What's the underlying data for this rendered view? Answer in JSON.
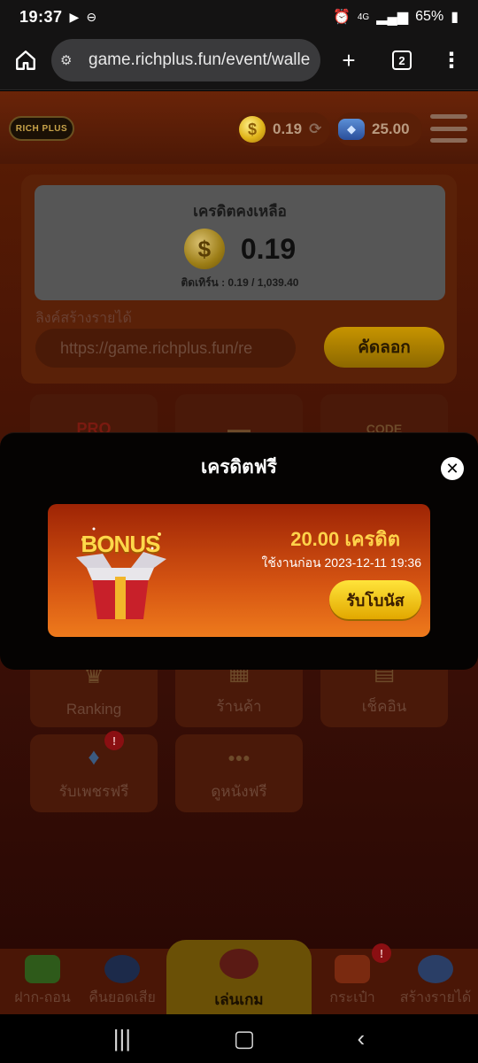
{
  "status_bar": {
    "time": "19:37",
    "battery": "65%",
    "network": "4G"
  },
  "browser": {
    "url": "game.richplus.fun/event/walle",
    "tab_count": "2"
  },
  "header": {
    "logo_text": "RICH PLUS",
    "coin_balance": "0.19",
    "gem_balance": "25.00"
  },
  "wallet": {
    "remaining_label": "เครดิตคงเหลือ",
    "remaining_value": "0.19",
    "turnover_text": "ติดเทิร์น : 0.19 / 1,039.40",
    "referral_label": "ลิงค์สร้างรายได้",
    "referral_url": "https://game.richplus.fun/re",
    "copy_label": "คัดลอก"
  },
  "tiles": [
    {
      "label": "Ranking"
    },
    {
      "label": "ร้านค้า"
    },
    {
      "label": "เช็คอิน"
    },
    {
      "label": "รับเพชรฟรี"
    },
    {
      "label": "ดูหนังฟรี"
    }
  ],
  "modal": {
    "title": "เครดิตฟรี",
    "bonus_art_text": "BONUS",
    "amount": "20.00 เครดิต",
    "expire": "ใช้งานก่อน 2023-12-11 19:36",
    "claim_label": "รับโบนัส"
  },
  "bottom_nav": [
    {
      "label": "ฝาก-ถอน"
    },
    {
      "label": "คืนยอดเสีย"
    },
    {
      "label": "เล่นเกม"
    },
    {
      "label": "กระเป๋า"
    },
    {
      "label": "สร้างรายได้"
    }
  ],
  "colors": {
    "accent_gold": "#ffd24a",
    "modal_bg": "#050302",
    "bonus_gradient_top": "#9e2405",
    "bonus_gradient_bottom": "#ee7a1c"
  }
}
